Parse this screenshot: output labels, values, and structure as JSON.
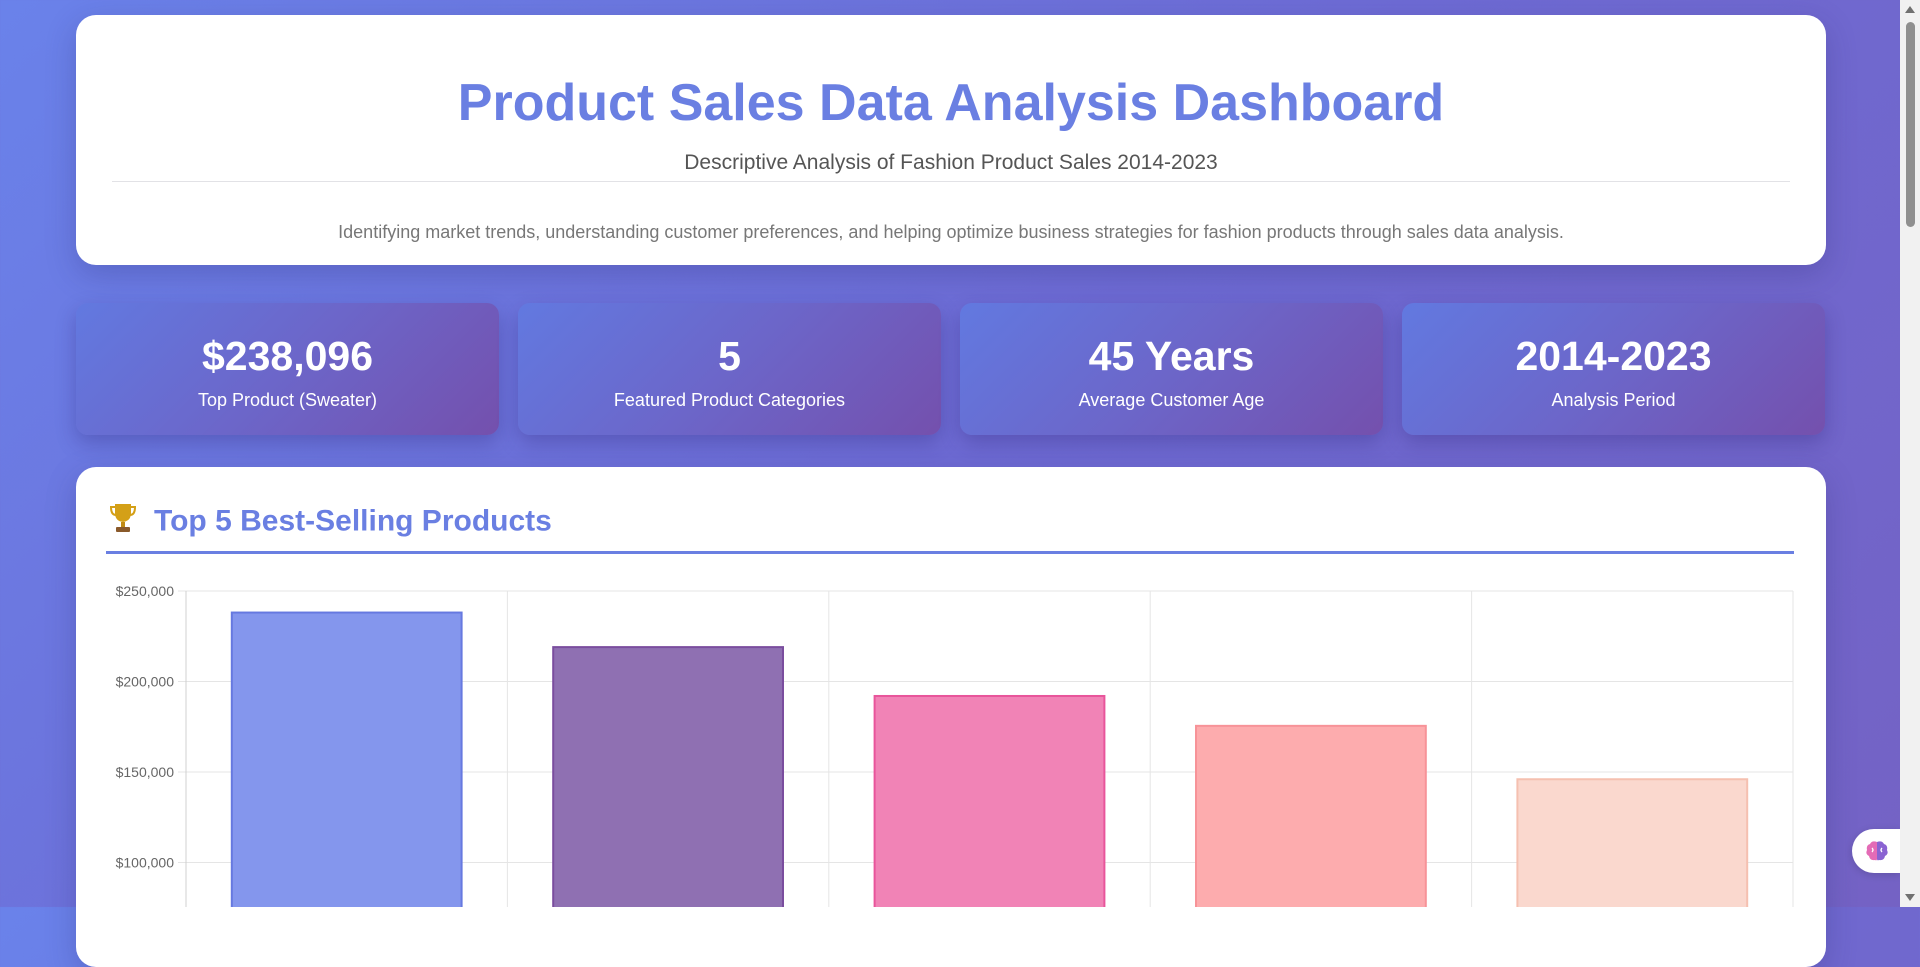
{
  "header": {
    "title": "Product Sales Data Analysis Dashboard",
    "subtitle": "Descriptive Analysis of Fashion Product Sales 2014-2023",
    "description": "Identifying market trends, understanding customer preferences, and helping optimize business strategies for fashion products through sales data analysis."
  },
  "stats": [
    {
      "value": "$238,096",
      "label": "Top Product (Sweater)"
    },
    {
      "value": "5",
      "label": "Featured Product Categories"
    },
    {
      "value": "45 Years",
      "label": "Average Customer Age"
    },
    {
      "value": "2014-2023",
      "label": "Analysis Period"
    }
  ],
  "chart_section": {
    "icon": "trophy-icon",
    "title": "Top 5 Best-Selling Products"
  },
  "chart_data": {
    "type": "bar",
    "title": "Top 5 Best-Selling Products",
    "values": [
      238096,
      219000,
      192000,
      175500,
      146000
    ],
    "colors": [
      "#8496ed",
      "#8f70b2",
      "#f183b6",
      "#fdacae",
      "#fad8ce"
    ],
    "border_colors": [
      "#6679e0",
      "#7a4d9e",
      "#e8559b",
      "#f79398",
      "#f5c0b0"
    ],
    "y_ticks": [
      "$250,000",
      "$200,000",
      "$150,000",
      "$100,000"
    ],
    "y_tick_values": [
      250000,
      200000,
      150000,
      100000
    ],
    "ylim": [
      0,
      250000
    ],
    "grid": true
  },
  "colors": {
    "accent": "#6a7fe2",
    "background_start": "#6a82ea",
    "background_end": "#7462c4"
  }
}
